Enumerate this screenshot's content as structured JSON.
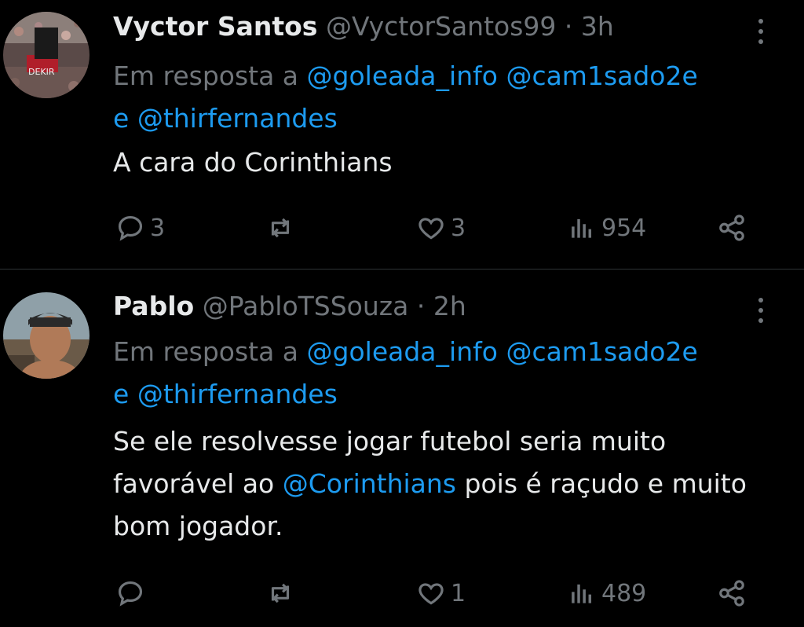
{
  "tweets": [
    {
      "name": "Vyctor Santos",
      "handle": "@VyctorSantos99",
      "dot": "·",
      "time": "3h",
      "reply_prefix": "Em resposta a",
      "mentions": [
        "@goleada_info",
        "@cam1sado2e",
        "@thirfernandes"
      ],
      "and_word": "e",
      "text": "A cara do Corinthians",
      "avatar_text": "DEKIR",
      "replies": "3",
      "reposts": "",
      "likes": "3",
      "views": "954"
    },
    {
      "name": "Pablo",
      "handle": "@PabloTSSouza",
      "dot": "·",
      "time": "2h",
      "reply_prefix": "Em resposta a",
      "mentions": [
        "@goleada_info",
        "@cam1sado2e",
        "@thirfernandes"
      ],
      "and_word": "e",
      "text_part1": "Se ele resolvesse jogar futebol seria muito favorável ao",
      "text_mention": "@Corinthians",
      "text_part2": "pois é raçudo e muito bom jogador.",
      "replies": "",
      "reposts": "",
      "likes": "1",
      "views": "489"
    }
  ],
  "colors": {
    "background": "#000000",
    "text": "#e7e9ea",
    "muted": "#71767b",
    "link": "#1d9bf0",
    "divider": "#2f3336"
  },
  "icons": [
    "reply-icon",
    "repost-icon",
    "like-icon",
    "views-icon",
    "share-icon",
    "more-icon"
  ]
}
